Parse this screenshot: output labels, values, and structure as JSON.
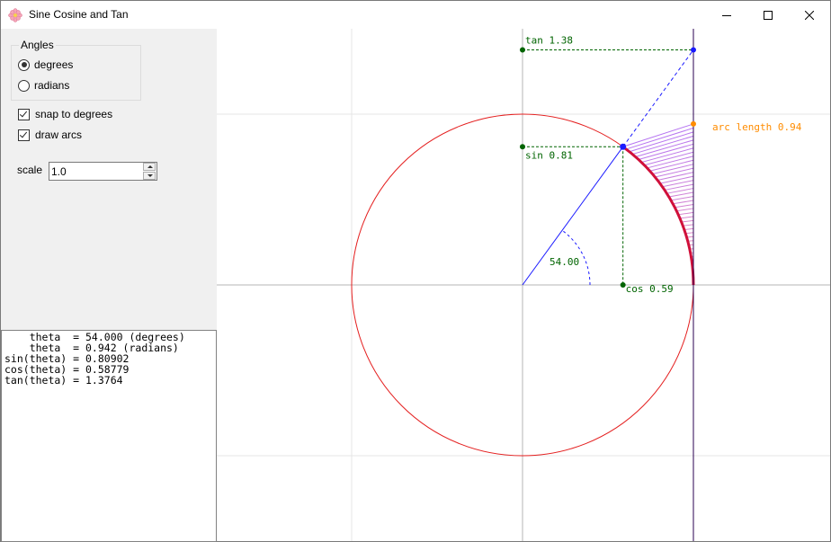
{
  "window": {
    "title": "Sine Cosine and Tan",
    "app_icon": "flower-icon",
    "controls": [
      "minimize-icon",
      "maximize-icon",
      "close-icon"
    ]
  },
  "angles_group": {
    "label": "Angles",
    "options": [
      {
        "label": "degrees",
        "checked": true
      },
      {
        "label": "radians",
        "checked": false
      }
    ]
  },
  "checkboxes": {
    "snap_to_degrees": {
      "label": "snap to degrees",
      "checked": true
    },
    "draw_arcs": {
      "label": "draw arcs",
      "checked": true
    }
  },
  "scale": {
    "label": "scale",
    "value": "1.0"
  },
  "output": {
    "lines": [
      "    theta  = 54.000 (degrees)",
      "    theta  = 0.942 (radians)",
      "sin(theta) = 0.80902",
      "cos(theta) = 0.58779",
      "tan(theta) = 1.3764"
    ]
  },
  "plot": {
    "theta_degrees": 54,
    "angle_label": "54.00",
    "sin_label": "sin 0.81",
    "cos_label": "cos 0.59",
    "tan_label": "tan 1.38",
    "arc_label": "arc length 0.94",
    "colors": {
      "circle": "#e41e1e",
      "radius": "#1a1aff",
      "guide": "#006400",
      "arc_label": "#ff8c00",
      "axis": "#b4b4b4",
      "grid": "#e6e6e6",
      "tangent_line": "#2a0050"
    }
  }
}
